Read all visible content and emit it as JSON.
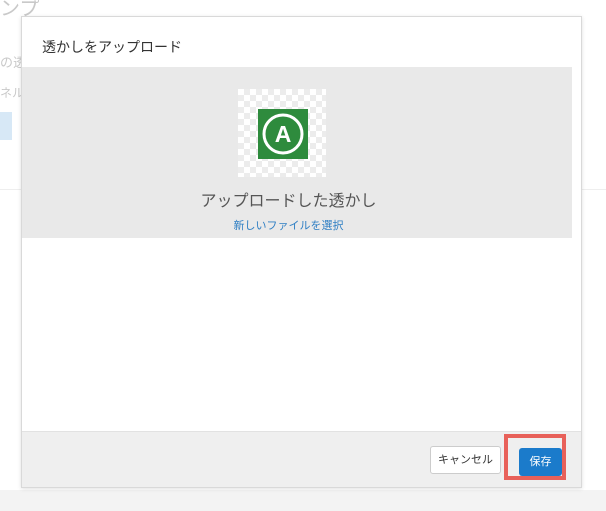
{
  "background": {
    "title": "ンプ",
    "line1": "の透",
    "line2": "ネル"
  },
  "modal": {
    "title": "透かしをアップロード",
    "upload": {
      "label": "アップロードした透かし",
      "change_link": "新しいファイルを選択",
      "logo_letter": "A"
    },
    "footer": {
      "cancel_label": "キャンセル",
      "save_label": "保存"
    }
  },
  "colors": {
    "logo_green": "#2e8b3d",
    "primary_blue": "#1b7bcb",
    "link_blue": "#2f7fc4",
    "highlight_red": "#e8615a"
  }
}
